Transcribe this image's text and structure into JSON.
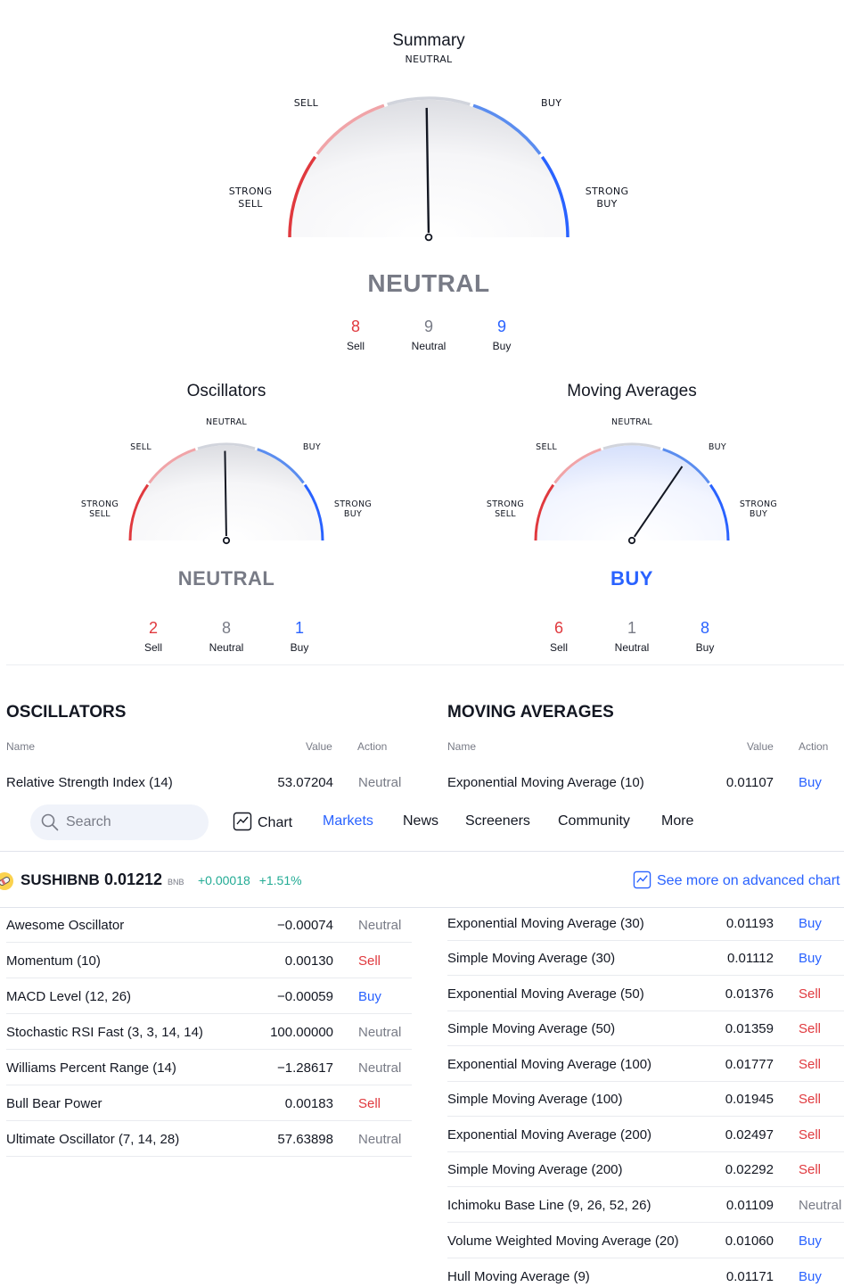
{
  "summary": {
    "title": "Summary",
    "verdict": "NEUTRAL",
    "labels": {
      "neutral": "NEUTRAL",
      "sell": "SELL",
      "buy": "BUY",
      "strong_sell_1": "STRONG",
      "strong_sell_2": "SELL",
      "strong_buy_1": "STRONG",
      "strong_buy_2": "BUY"
    },
    "needle_value": 0.495,
    "counts": [
      {
        "num": "8",
        "label": "Sell"
      },
      {
        "num": "9",
        "label": "Neutral"
      },
      {
        "num": "9",
        "label": "Buy"
      }
    ]
  },
  "oscillators_gauge": {
    "title": "Oscillators",
    "verdict": "NEUTRAL",
    "labels": {
      "neutral": "NEUTRAL",
      "sell": "SELL",
      "buy": "BUY",
      "strong_sell_1": "STRONG",
      "strong_sell_2": "SELL",
      "strong_buy_1": "STRONG",
      "strong_buy_2": "BUY"
    },
    "needle_value": 0.495,
    "counts": [
      {
        "num": "2",
        "label": "Sell"
      },
      {
        "num": "8",
        "label": "Neutral"
      },
      {
        "num": "1",
        "label": "Buy"
      }
    ]
  },
  "ma_gauge": {
    "title": "Moving Averages",
    "verdict": "BUY",
    "labels": {
      "neutral": "NEUTRAL",
      "sell": "SELL",
      "buy": "BUY",
      "strong_sell_1": "STRONG",
      "strong_sell_2": "SELL",
      "strong_buy_1": "STRONG",
      "strong_buy_2": "BUY"
    },
    "needle_value": 0.69,
    "counts": [
      {
        "num": "6",
        "label": "Sell"
      },
      {
        "num": "1",
        "label": "Neutral"
      },
      {
        "num": "8",
        "label": "Buy"
      }
    ]
  },
  "colors": {
    "sell": "#e0393e",
    "sell_light": "#f0a4a8",
    "neutral": "#787b86",
    "neutral_arc": "#d1d4dc",
    "buy": "#2962ff",
    "buy_light": "#5b8def",
    "positive_change": "#22ab94"
  },
  "oscillators_table": {
    "title": "OSCILLATORS",
    "headers": {
      "name": "Name",
      "value": "Value",
      "action": "Action"
    },
    "rows": [
      {
        "name": "Relative Strength Index (14)",
        "value": "53.07204",
        "action": "Neutral"
      },
      {
        "name": "Awesome Oscillator",
        "value": "−0.00074",
        "action": "Neutral"
      },
      {
        "name": "Momentum (10)",
        "value": "0.00130",
        "action": "Sell"
      },
      {
        "name": "MACD Level (12, 26)",
        "value": "−0.00059",
        "action": "Buy"
      },
      {
        "name": "Stochastic RSI Fast (3, 3, 14, 14)",
        "value": "100.00000",
        "action": "Neutral"
      },
      {
        "name": "Williams Percent Range (14)",
        "value": "−1.28617",
        "action": "Neutral"
      },
      {
        "name": "Bull Bear Power",
        "value": "0.00183",
        "action": "Sell"
      },
      {
        "name": "Ultimate Oscillator (7, 14, 28)",
        "value": "57.63898",
        "action": "Neutral"
      }
    ]
  },
  "ma_table": {
    "title": "MOVING AVERAGES",
    "headers": {
      "name": "Name",
      "value": "Value",
      "action": "Action"
    },
    "rows": [
      {
        "name": "Exponential Moving Average (10)",
        "value": "0.01107",
        "action": "Buy"
      },
      {
        "name": "Exponential Moving Average (30)",
        "value": "0.01193",
        "action": "Buy"
      },
      {
        "name": "Simple Moving Average (30)",
        "value": "0.01112",
        "action": "Buy"
      },
      {
        "name": "Exponential Moving Average (50)",
        "value": "0.01376",
        "action": "Sell"
      },
      {
        "name": "Simple Moving Average (50)",
        "value": "0.01359",
        "action": "Sell"
      },
      {
        "name": "Exponential Moving Average (100)",
        "value": "0.01777",
        "action": "Sell"
      },
      {
        "name": "Simple Moving Average (100)",
        "value": "0.01945",
        "action": "Sell"
      },
      {
        "name": "Exponential Moving Average (200)",
        "value": "0.02497",
        "action": "Sell"
      },
      {
        "name": "Simple Moving Average (200)",
        "value": "0.02292",
        "action": "Sell"
      },
      {
        "name": "Ichimoku Base Line (9, 26, 52, 26)",
        "value": "0.01109",
        "action": "Neutral"
      },
      {
        "name": "Volume Weighted Moving Average (20)",
        "value": "0.01060",
        "action": "Buy"
      },
      {
        "name": "Hull Moving Average (9)",
        "value": "0.01171",
        "action": "Buy"
      }
    ]
  },
  "navbar": {
    "search_placeholder": "Search",
    "items": [
      {
        "label": "Chart",
        "icon": "chart-icon"
      },
      {
        "label": "Markets",
        "active": true
      },
      {
        "label": "News"
      },
      {
        "label": "Screeners"
      },
      {
        "label": "Community"
      },
      {
        "label": "More"
      }
    ]
  },
  "ticker": {
    "symbol": "SUSHIBNB",
    "price": "0.01212",
    "currency": "BNB",
    "change": "+0.00018",
    "change_pct": "+1.51%",
    "advanced_link": "See more on advanced chart",
    "logo_icon": "sushi-logo-icon"
  }
}
